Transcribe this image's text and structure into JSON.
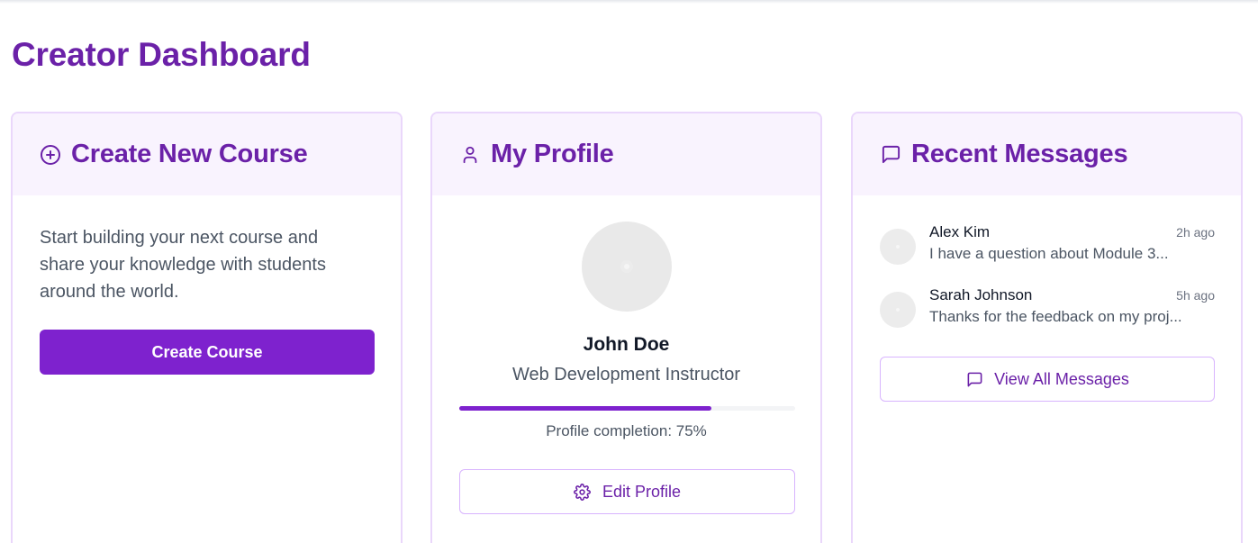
{
  "page": {
    "title": "Creator Dashboard"
  },
  "colors": {
    "brand": "#6b21a8",
    "accent": "#7e22ce",
    "card_header_bg": "#f9f3fe",
    "card_border": "#ead7fb"
  },
  "create_card": {
    "icon": "plus-circle-icon",
    "title": "Create New Course",
    "description": "Start building your next course and share your knowledge with students around the world.",
    "button_label": "Create Course"
  },
  "profile_card": {
    "icon": "user-icon",
    "title": "My Profile",
    "name": "John Doe",
    "role": "Web Development Instructor",
    "completion_percent": 75,
    "completion_text": "Profile completion: 75%",
    "edit_icon": "gear-icon",
    "edit_label": "Edit Profile"
  },
  "messages_card": {
    "icon": "message-square-icon",
    "title": "Recent Messages",
    "messages": [
      {
        "sender": "Alex Kim",
        "time": "2h ago",
        "text": "I have a question about Module 3..."
      },
      {
        "sender": "Sarah Johnson",
        "time": "5h ago",
        "text": "Thanks for the feedback on my proj..."
      }
    ],
    "view_all_icon": "message-square-icon",
    "view_all_label": "View All Messages"
  }
}
